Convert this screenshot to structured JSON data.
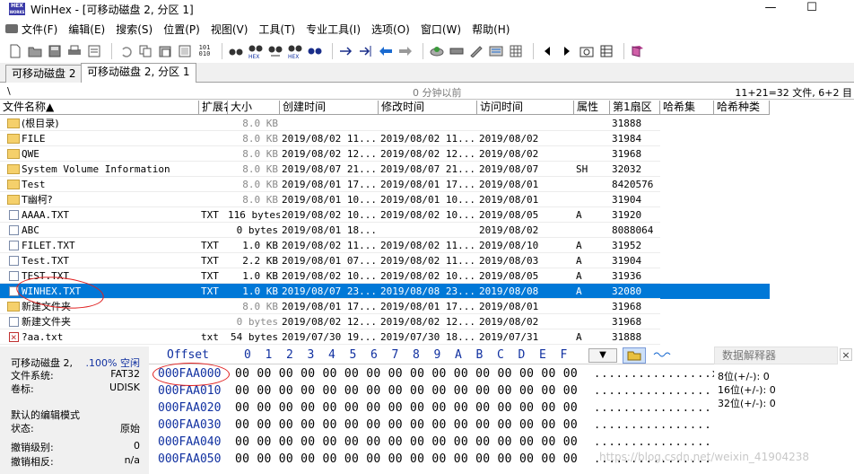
{
  "window": {
    "title": "WinHex - [可移动磁盘 2, 分区 1]",
    "icon_text_top": "HEX",
    "icon_text_bottom": "WORKS",
    "minimize": "—",
    "maximize": "☐"
  },
  "menu": [
    {
      "label": "文件(F)"
    },
    {
      "label": "编辑(E)"
    },
    {
      "label": "搜索(S)"
    },
    {
      "label": "位置(P)"
    },
    {
      "label": "视图(V)"
    },
    {
      "label": "工具(T)"
    },
    {
      "label": "专业工具(I)"
    },
    {
      "label": "选项(O)"
    },
    {
      "label": "窗口(W)"
    },
    {
      "label": "帮助(H)"
    }
  ],
  "toolbar": {
    "icons": [
      "new-icon",
      "open-icon",
      "save-icon",
      "print-icon",
      "properties-icon",
      "undo-icon",
      "copy-icon",
      "paste-icon",
      "paste-special-icon",
      "hex-clip-icon",
      "find-icon",
      "find-hex-icon",
      "replace-icon",
      "replace-hex-icon",
      "find-next-icon",
      "goto-icon",
      "goto-offset-icon",
      "back-icon",
      "forward-icon",
      "disk-icon",
      "ram-icon",
      "tools-icon",
      "calculator-icon",
      "grid-icon",
      "prev-icon",
      "next-icon",
      "snapshot-icon",
      "map-icon",
      "help-book-icon"
    ],
    "hex_label": "HEX",
    "num_label": "101 010"
  },
  "tabs": [
    {
      "label": "可移动磁盘 2"
    },
    {
      "label": "可移动磁盘 2, 分区 1"
    }
  ],
  "pathbar": {
    "path": "\\",
    "time": "0 分钟以前",
    "count": "11+21=32 文件, 6+2 目"
  },
  "columns": [
    "文件名称▲",
    "扩展名",
    "大小",
    "创建时间",
    "修改时间",
    "访问时间",
    "属性",
    "第1扇区",
    "哈希集",
    "哈希种类"
  ],
  "files": [
    {
      "icon": "folder",
      "name": "(根目录)",
      "ext": "",
      "size": "8.0 KB",
      "sgray": true,
      "created": "",
      "modified": "",
      "accessed": "",
      "attr": "",
      "sector": "31888"
    },
    {
      "icon": "folder",
      "name": "FILE",
      "ext": "",
      "size": "8.0 KB",
      "sgray": true,
      "created": "2019/08/02  11...",
      "modified": "2019/08/02  11...",
      "accessed": "2019/08/02",
      "attr": "",
      "sector": "31984"
    },
    {
      "icon": "folder",
      "name": "QWE",
      "ext": "",
      "size": "8.0 KB",
      "sgray": true,
      "created": "2019/08/02  12...",
      "modified": "2019/08/02  12...",
      "accessed": "2019/08/02",
      "attr": "",
      "sector": "31968"
    },
    {
      "icon": "folder",
      "name": "System Volume Information",
      "ext": "",
      "size": "8.0 KB",
      "sgray": true,
      "created": "2019/08/07  21...",
      "modified": "2019/08/07  21...",
      "accessed": "2019/08/07",
      "attr": "SH",
      "sector": "32032"
    },
    {
      "icon": "folder",
      "name": "Test",
      "ext": "",
      "size": "8.0 KB",
      "sgray": true,
      "created": "2019/08/01  17...",
      "modified": "2019/08/01  17...",
      "accessed": "2019/08/01",
      "attr": "",
      "sector": "8420576"
    },
    {
      "icon": "folder",
      "name": "T幽柯?",
      "ext": "",
      "size": "8.0 KB",
      "sgray": true,
      "created": "2019/08/01  10...",
      "modified": "2019/08/01  10...",
      "accessed": "2019/08/01",
      "attr": "",
      "sector": "31904"
    },
    {
      "icon": "file",
      "name": "AAAA.TXT",
      "ext": "TXT",
      "size": "116 bytes",
      "sgray": false,
      "created": "2019/08/02  10...",
      "modified": "2019/08/02  10...",
      "accessed": "2019/08/05",
      "attr": "A",
      "sector": "31920"
    },
    {
      "icon": "file",
      "name": "ABC",
      "ext": "",
      "size": "0 bytes",
      "sgray": false,
      "created": "2019/08/01  18...",
      "modified": "",
      "accessed": "2019/08/02",
      "attr": "",
      "sector": "8088064"
    },
    {
      "icon": "file",
      "name": "FILET.TXT",
      "ext": "TXT",
      "size": "1.0 KB",
      "sgray": false,
      "created": "2019/08/02  11...",
      "modified": "2019/08/02  11...",
      "accessed": "2019/08/10",
      "attr": "A",
      "sector": "31952"
    },
    {
      "icon": "file",
      "name": "Test.TXT",
      "ext": "TXT",
      "size": "2.2 KB",
      "sgray": false,
      "created": "2019/08/01  07...",
      "modified": "2019/08/02  11...",
      "accessed": "2019/08/03",
      "attr": "A",
      "sector": "31904"
    },
    {
      "icon": "file",
      "name": "TEST.TXT",
      "ext": "TXT",
      "size": "1.0 KB",
      "sgray": false,
      "created": "2019/08/02  10...",
      "modified": "2019/08/02  10...",
      "accessed": "2019/08/05",
      "attr": "A",
      "sector": "31936"
    },
    {
      "icon": "file",
      "name": "WINHEX.TXT",
      "ext": "TXT",
      "size": "1.0 KB",
      "sgray": false,
      "created": "2019/08/07  23...",
      "modified": "2019/08/08  23...",
      "accessed": "2019/08/08",
      "attr": "A",
      "sector": "32080",
      "selected": true
    },
    {
      "icon": "folder",
      "name": "新建文件夹",
      "ext": "",
      "size": "8.0 KB",
      "sgray": true,
      "created": "2019/08/01  17...",
      "modified": "2019/08/01  17...",
      "accessed": "2019/08/01",
      "attr": "",
      "sector": "31968"
    },
    {
      "icon": "file",
      "name": "新建文件夹",
      "ext": "",
      "size": "0 bytes",
      "sgray": true,
      "created": "2019/08/02  12...",
      "modified": "2019/08/02  12...",
      "accessed": "2019/08/02",
      "attr": "",
      "sector": "31968"
    },
    {
      "icon": "deleted",
      "name": "?aa.txt",
      "ext": "txt",
      "size": "54 bytes",
      "sgray": false,
      "created": "2019/07/30  19...",
      "modified": "2019/07/30  18...",
      "accessed": "2019/07/31",
      "attr": "A",
      "sector": "31888"
    }
  ],
  "info": {
    "disk": "可移动磁盘 2,",
    "free": ".100% 空闲",
    "fs_label": "文件系统:",
    "fs_value": "FAT32",
    "vol_label": "卷标:",
    "vol_value": "UDISK",
    "edit_mode_label": "默认的编辑模式",
    "state_label": "状态:",
    "state_value": "原始",
    "undo_level_label": "撤销级别:",
    "undo_level_value": "0",
    "undo_rev_label": "撤销相反:",
    "undo_rev_value": "n/a"
  },
  "hex": {
    "offset_label": "Offset",
    "columns": [
      "0",
      "1",
      "2",
      "3",
      "4",
      "5",
      "6",
      "7",
      "8",
      "9",
      "A",
      "B",
      "C",
      "D",
      "E",
      "F"
    ],
    "rows": [
      {
        "offset": "000FAA000",
        "bytes": "00 00 00 00 00 00 00 00 00 00 00 00 00 00 00 00",
        "ascii": "................x"
      },
      {
        "offset": "000FAA010",
        "bytes": "00 00 00 00 00 00 00 00 00 00 00 00 00 00 00 00",
        "ascii": "................"
      },
      {
        "offset": "000FAA020",
        "bytes": "00 00 00 00 00 00 00 00 00 00 00 00 00 00 00 00",
        "ascii": "................"
      },
      {
        "offset": "000FAA030",
        "bytes": "00 00 00 00 00 00 00 00 00 00 00 00 00 00 00 00",
        "ascii": "................"
      },
      {
        "offset": "000FAA040",
        "bytes": "00 00 00 00 00 00 00 00 00 00 00 00 00 00 00 00",
        "ascii": "................"
      },
      {
        "offset": "000FAA050",
        "bytes": "00 00 00 00 00 00 00 00 00 00 00 00 00 00 00 00",
        "ascii": "................"
      }
    ]
  },
  "interpreter": {
    "title": "数据解释器",
    "close": "×",
    "rows": [
      {
        "label": "8位(+/-):",
        "value": "0"
      },
      {
        "label": "16位(+/-):",
        "value": "0"
      },
      {
        "label": "32位(+/-):",
        "value": "0"
      }
    ]
  },
  "watermark": "https://blog.csdn.net/weixin_41904238",
  "colors": {
    "selection": "#0078d7",
    "annotation": "#e02020",
    "offset": "#1030a0"
  }
}
